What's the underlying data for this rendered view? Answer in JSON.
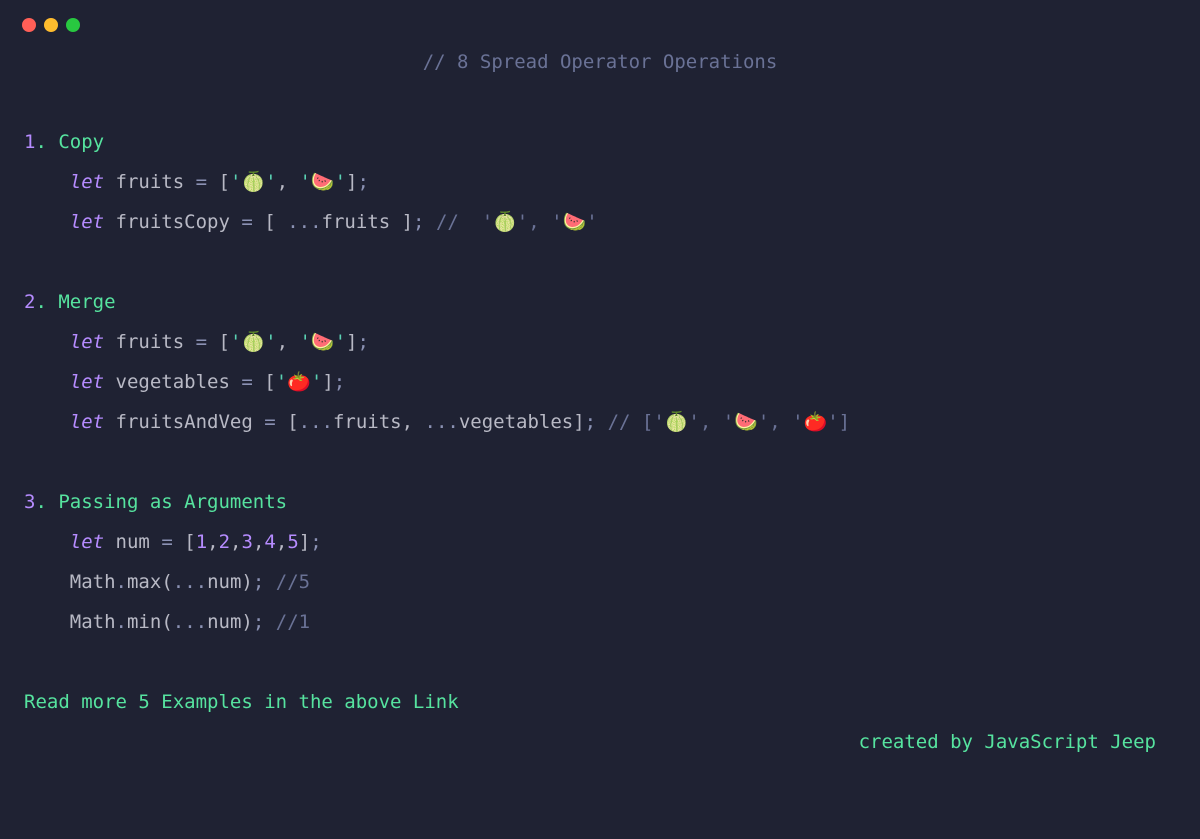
{
  "window": {
    "title_comment": "// 8 Spread Operator Operations"
  },
  "sections": {
    "s1": {
      "num": "1",
      "dot": ". ",
      "title": "Copy",
      "l1_indent": "    ",
      "l1_let": "let",
      "l1_sp1": " ",
      "l1_var": "fruits",
      "l1_sp2": " ",
      "l1_eq": "=",
      "l1_sp3": " ",
      "l1_lb": "[",
      "l1_q1a": "'",
      "l1_e1": "🍈",
      "l1_q1b": "'",
      "l1_comma": ", ",
      "l1_q2a": "'",
      "l1_e2": "🍉",
      "l1_q2b": "'",
      "l1_rb": "]",
      "l1_semi": ";",
      "l2_indent": "    ",
      "l2_let": "let",
      "l2_sp1": " ",
      "l2_var": "fruitsCopy",
      "l2_sp2": " ",
      "l2_eq": "=",
      "l2_sp3": " ",
      "l2_lb": "[ ",
      "l2_spread": "...",
      "l2_ref": "fruits",
      "l2_rb": " ]",
      "l2_semi": "; ",
      "l2_comment": "//  '🍈', '🍉'"
    },
    "s2": {
      "num": "2",
      "dot": ". ",
      "title": "Merge",
      "l1_indent": "    ",
      "l1_let": "let",
      "l1_sp1": " ",
      "l1_var": "fruits",
      "l1_sp2": " ",
      "l1_eq": "=",
      "l1_sp3": " ",
      "l1_lb": "[",
      "l1_q1a": "'",
      "l1_e1": "🍈",
      "l1_q1b": "'",
      "l1_comma": ", ",
      "l1_q2a": "'",
      "l1_e2": "🍉",
      "l1_q2b": "'",
      "l1_rb": "]",
      "l1_semi": ";",
      "l2_indent": "    ",
      "l2_let": "let",
      "l2_sp1": " ",
      "l2_var": "vegetables",
      "l2_sp2": " ",
      "l2_eq": "=",
      "l2_sp3": " ",
      "l2_lb": "[",
      "l2_q1a": "'",
      "l2_e1": "🍅",
      "l2_q1b": "'",
      "l2_rb": "]",
      "l2_semi": ";",
      "l3_indent": "    ",
      "l3_let": "let",
      "l3_sp1": " ",
      "l3_var": "fruitsAndVeg",
      "l3_sp2": " ",
      "l3_eq": "=",
      "l3_sp3": " ",
      "l3_lb": "[",
      "l3_spread1": "...",
      "l3_ref1": "fruits",
      "l3_comma": ", ",
      "l3_spread2": "...",
      "l3_ref2": "vegetables",
      "l3_rb": "]",
      "l3_semi": "; ",
      "l3_comment": "// ['🍈', '🍉', '🍅']"
    },
    "s3": {
      "num": "3",
      "dot": ". ",
      "title": "Passing as Arguments",
      "l1_indent": "    ",
      "l1_let": "let",
      "l1_sp1": " ",
      "l1_var": "num",
      "l1_sp2": " ",
      "l1_eq": "=",
      "l1_sp3": " ",
      "l1_lb": "[",
      "l1_n1": "1",
      "l1_c1": ",",
      "l1_n2": "2",
      "l1_c2": ",",
      "l1_n3": "3",
      "l1_c3": ",",
      "l1_n4": "4",
      "l1_c4": ",",
      "l1_n5": "5",
      "l1_rb": "]",
      "l1_semi": ";",
      "l2_indent": "    ",
      "l2_obj": "Math",
      "l2_dot": ".",
      "l2_fn": "max",
      "l2_lp": "(",
      "l2_spread": "...",
      "l2_ref": "num",
      "l2_rp": ")",
      "l2_semi": "; ",
      "l2_comment": "//5",
      "l3_indent": "    ",
      "l3_obj": "Math",
      "l3_dot": ".",
      "l3_fn": "min",
      "l3_lp": "(",
      "l3_spread": "...",
      "l3_ref": "num",
      "l3_rp": ")",
      "l3_semi": "; ",
      "l3_comment": "//1"
    }
  },
  "footer": {
    "link_text": "Read more 5 Examples in the above Link",
    "attribution": "created by JavaScript Jeep"
  }
}
